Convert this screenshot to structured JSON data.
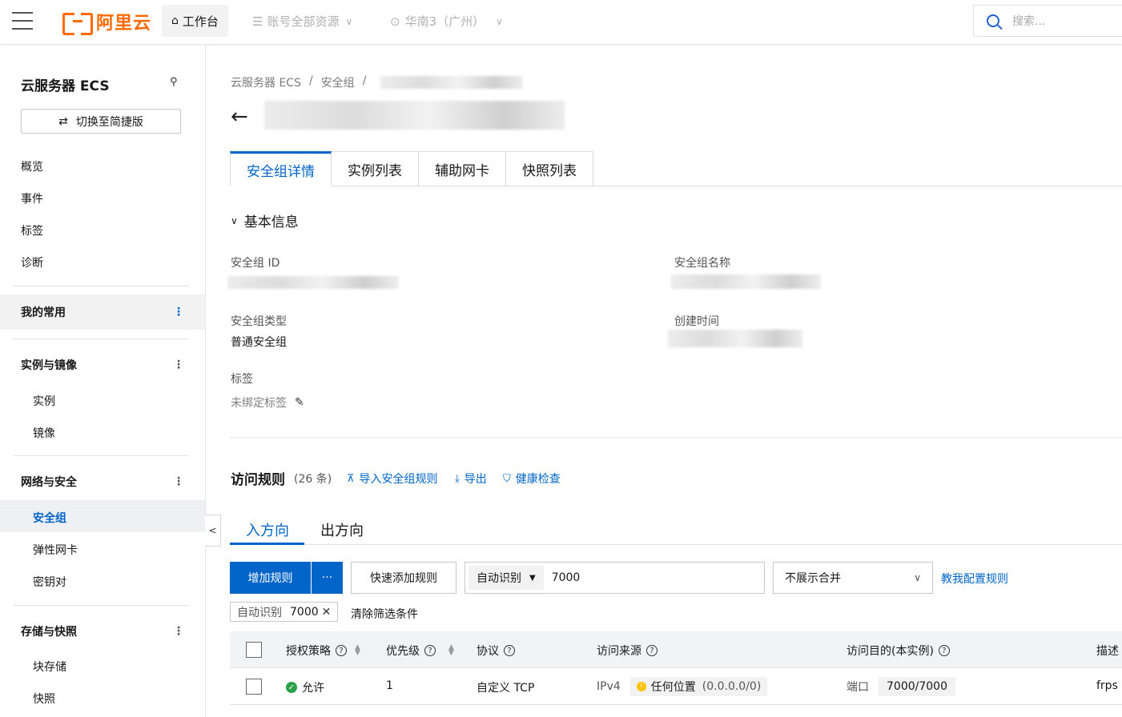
{
  "topbar": {
    "brand": "阿里云",
    "workbench": "工作台",
    "account_scope": "账号全部资源",
    "region": "华南3（广州）",
    "search_placeholder": "搜索..."
  },
  "sidebar": {
    "title": "云服务器 ECS",
    "switch_label": "切换至简捷版",
    "top_items": [
      "概览",
      "事件",
      "标签",
      "诊断"
    ],
    "favorites": "我的常用",
    "groups": {
      "instances": {
        "label": "实例与镜像",
        "items": [
          "实例",
          "镜像"
        ]
      },
      "network": {
        "label": "网络与安全",
        "items": [
          "安全组",
          "弹性网卡",
          "密钥对"
        ]
      },
      "storage": {
        "label": "存储与快照",
        "items": [
          "块存储",
          "快照"
        ]
      }
    }
  },
  "breadcrumb": [
    "云服务器 ECS",
    "/",
    "安全组",
    "/"
  ],
  "tabs": [
    "安全组详情",
    "实例列表",
    "辅助网卡",
    "快照列表"
  ],
  "basic": {
    "title": "基本信息",
    "sg_id_label": "安全组 ID",
    "sg_name_label": "安全组名称",
    "sg_type_label": "安全组类型",
    "sg_type_value": "普通安全组",
    "created_label": "创建时间",
    "tag_label": "标签",
    "tag_value": "未绑定标签"
  },
  "rules": {
    "title": "访问规则",
    "count": "(26 条)",
    "import_label": "导入安全组规则",
    "export_label": "导出",
    "health_label": "健康检查",
    "inbound": "入方向",
    "outbound": "出方向",
    "add_rule": "增加规则",
    "more": "···",
    "quick_add": "快速添加规则",
    "filter_type": "自动识别",
    "filter_value": "7000",
    "merge_option": "不展示合并",
    "teach_link": "教我配置规则",
    "chip_key": "自动识别",
    "chip_value": "7000",
    "clear_filters": "清除筛选条件"
  },
  "table": {
    "headers": {
      "policy": "授权策略",
      "priority": "优先级",
      "protocol": "协议",
      "source": "访问来源",
      "dest": "访问目的(本实例)",
      "desc": "描述"
    },
    "rows": [
      {
        "policy": "允许",
        "priority": "1",
        "protocol": "自定义 TCP",
        "source_type": "IPv4",
        "source_value": "任何位置",
        "source_cidr": "(0.0.0.0/0)",
        "dest_label": "端口",
        "dest_value": "7000/7000",
        "desc": "frps"
      }
    ]
  },
  "colors": {
    "brand": "#ff6a00",
    "accent": "#0064c8",
    "success": "#2aa148",
    "warning": "#ffc300"
  }
}
